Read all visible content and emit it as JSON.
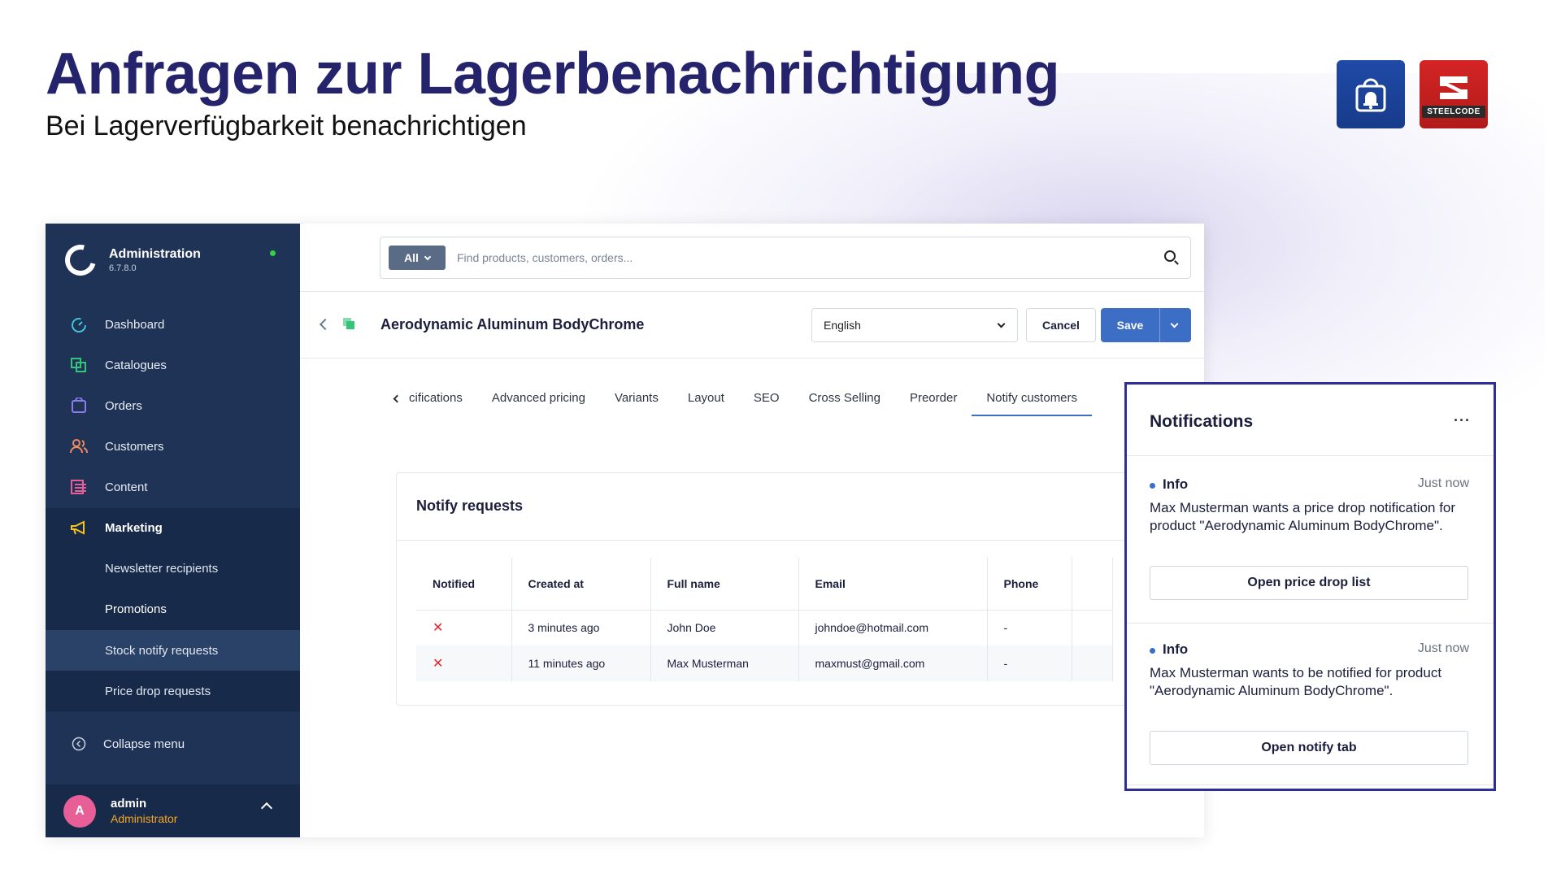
{
  "slide": {
    "title": "Anfragen zur Lagerbenachrichtigung",
    "subtitle": "Bei Lagerverfügbarkeit benachrichtigen",
    "logos": [
      {
        "name": "bell-bag-logo",
        "color": "#1f4aa8"
      },
      {
        "name": "steelcode-logo",
        "text": "STEELCODE",
        "color": "#d42525"
      }
    ]
  },
  "sidebar": {
    "app_name": "Administration",
    "version": "6.7.8.0",
    "status_color": "#37d046",
    "items": [
      {
        "label": "Dashboard",
        "icon": "gauge-icon"
      },
      {
        "label": "Catalogues",
        "icon": "catalogue-icon"
      },
      {
        "label": "Orders",
        "icon": "bag-icon"
      },
      {
        "label": "Customers",
        "icon": "users-icon"
      },
      {
        "label": "Content",
        "icon": "content-icon"
      },
      {
        "label": "Marketing",
        "icon": "megaphone-icon"
      }
    ],
    "sub_items": [
      {
        "label": "Newsletter recipients"
      },
      {
        "label": "Promotions"
      },
      {
        "label": "Stock notify requests",
        "selected": true
      },
      {
        "label": "Price drop requests"
      }
    ],
    "collapse_label": "Collapse menu",
    "user": {
      "initial": "A",
      "name": "admin",
      "role": "Administrator"
    }
  },
  "search": {
    "filter": "All",
    "placeholder": "Find products, customers, orders..."
  },
  "product": {
    "title": "Aerodynamic Aluminum BodyChrome",
    "language": "English",
    "cancel_label": "Cancel",
    "save_label": "Save"
  },
  "tabs": [
    {
      "label": "cifications"
    },
    {
      "label": "Advanced pricing"
    },
    {
      "label": "Variants"
    },
    {
      "label": "Layout"
    },
    {
      "label": "SEO"
    },
    {
      "label": "Cross Selling"
    },
    {
      "label": "Preorder"
    },
    {
      "label": "Notify customers",
      "active": true
    }
  ],
  "notify_card": {
    "title": "Notify requests",
    "columns": [
      "Notified",
      "Created at",
      "Full name",
      "Email",
      "Phone"
    ],
    "rows": [
      {
        "notified": "✕",
        "created_at": "3 minutes ago",
        "full_name": "John Doe",
        "email": "johndoe@hotmail.com",
        "phone": "-"
      },
      {
        "notified": "✕",
        "created_at": "11 minutes ago",
        "full_name": "Max Musterman",
        "email": "maxmust@gmail.com",
        "phone": "-"
      }
    ]
  },
  "notifications": {
    "title": "Notifications",
    "more": "···",
    "items": [
      {
        "type": "Info",
        "time": "Just now",
        "message": "Max Musterman wants a price drop notification for product \"Aerodynamic Aluminum BodyChrome\".",
        "button": "Open price drop list"
      },
      {
        "type": "Info",
        "time": "Just now",
        "message": "Max Musterman wants to be notified for product \"Aerodynamic Aluminum BodyChrome\".",
        "button": "Open notify tab"
      }
    ]
  },
  "colors": {
    "title": "#25236b",
    "sidebar": "#1f3356",
    "primary": "#3b6ec4",
    "highlight_border": "#2c2e9c",
    "error": "#e0262b"
  }
}
